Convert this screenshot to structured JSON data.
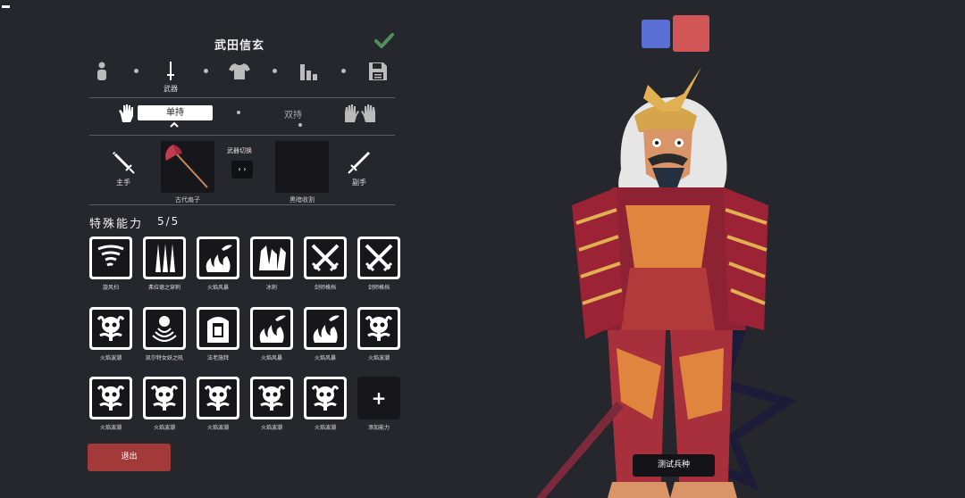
{
  "unit": {
    "name": "武田信玄"
  },
  "tabs": [
    {
      "icon": "body-icon"
    },
    {
      "icon": "sword-icon",
      "label": "武器"
    },
    {
      "icon": "shirt-icon"
    },
    {
      "icon": "stats-icon"
    },
    {
      "icon": "save-icon"
    }
  ],
  "grip": {
    "single": "单持",
    "dual": "双持"
  },
  "weapons": {
    "main_hand": "主手",
    "main_weapon": "古代扇子",
    "swap_title": "武器切换",
    "swap_symbol": "‹ ›",
    "off_weapon": "黑暗收割",
    "off_hand": "副手"
  },
  "abilities": {
    "title": "特殊能力",
    "count": "5/5",
    "rows": [
      [
        {
          "label": "旋风扫",
          "icon": "tornado-icon"
        },
        {
          "label": "弗拉德之穿刺",
          "icon": "spikes-icon"
        },
        {
          "label": "火焰风暴",
          "icon": "fire-storm-icon"
        },
        {
          "label": "冰刺",
          "icon": "ice-spike-icon"
        },
        {
          "label": "剑师格挡",
          "icon": "crossed-swords-icon"
        },
        {
          "label": "剑师格挡",
          "icon": "crossed-swords-icon"
        }
      ],
      [
        {
          "label": "火焰波潮",
          "icon": "skull-wave-icon"
        },
        {
          "label": "凯尔特女妖之吼",
          "icon": "banshee-icon"
        },
        {
          "label": "法老施拜",
          "icon": "pharaoh-icon"
        },
        {
          "label": "火焰风暴",
          "icon": "fire-storm-icon"
        },
        {
          "label": "火焰风暴",
          "icon": "fire-storm-icon"
        },
        {
          "label": "火焰波潮",
          "icon": "skull-wave-icon"
        }
      ],
      [
        {
          "label": "火焰波潮",
          "icon": "skull-wave-icon"
        },
        {
          "label": "火焰波潮",
          "icon": "skull-wave-icon"
        },
        {
          "label": "火焰波潮",
          "icon": "skull-wave-icon"
        },
        {
          "label": "火焰波潮",
          "icon": "skull-wave-icon"
        },
        {
          "label": "火焰波潮",
          "icon": "skull-wave-icon"
        }
      ]
    ],
    "add_label": "添加能力",
    "add_symbol": "+"
  },
  "exit_label": "退出",
  "test_label": "测试兵种",
  "team_colors": {
    "blue": "#5a6fd6",
    "red": "#d05656"
  }
}
